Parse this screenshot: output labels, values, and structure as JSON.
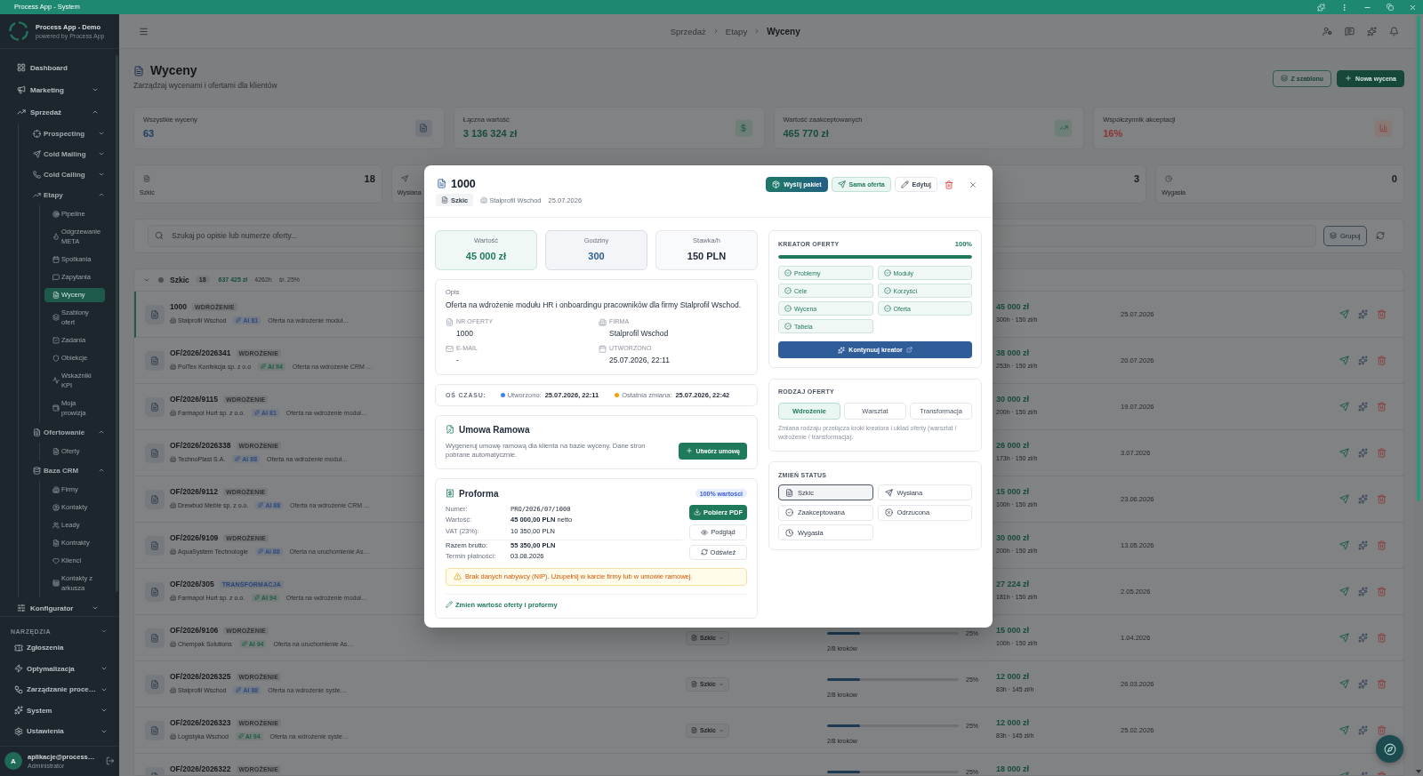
{
  "titlebar": {
    "title": "Process App - System"
  },
  "sidebar": {
    "app_name": "Process App - Demo",
    "tagline": "powered by Process App",
    "items": [
      {
        "label": "Dashboard",
        "selected": false
      },
      {
        "label": "Marketing",
        "selected": false,
        "expanded": false
      },
      {
        "label": "Sprzedaż",
        "selected": false,
        "expanded": true,
        "children": [
          {
            "label": "Prospecting",
            "selected": false,
            "expanded": false
          },
          {
            "label": "Cold Mailing",
            "selected": false,
            "expanded": false
          },
          {
            "label": "Cold Calling",
            "selected": false,
            "expanded": false
          },
          {
            "label": "Etapy",
            "selected": false,
            "expanded": true,
            "children": [
              {
                "label": "Pipeline",
                "selected": false
              },
              {
                "label": "Odgrzewanie META",
                "selected": false
              },
              {
                "label": "Spotkania",
                "selected": false
              },
              {
                "label": "Zapytania",
                "selected": false
              },
              {
                "label": "Wyceny",
                "selected": true
              },
              {
                "label": "Szablony ofert",
                "selected": false
              },
              {
                "label": "Zadania",
                "selected": false
              },
              {
                "label": "Obiekcje",
                "selected": false
              },
              {
                "label": "Wskaźniki KPI",
                "selected": false
              },
              {
                "label": "Moja prowizja",
                "selected": false
              }
            ]
          },
          {
            "label": "Ofertowanie",
            "selected": false,
            "expanded": true,
            "children": [
              {
                "label": "Oferty",
                "selected": false
              }
            ]
          },
          {
            "label": "Baza CRM",
            "selected": false,
            "expanded": true,
            "children": [
              {
                "label": "Firmy",
                "selected": false
              },
              {
                "label": "Kontakty",
                "selected": false
              },
              {
                "label": "Leady",
                "selected": false
              },
              {
                "label": "Kontrakty",
                "selected": false
              },
              {
                "label": "Klienci",
                "selected": false
              },
              {
                "label": "Kontakty z arkusza",
                "selected": false
              }
            ]
          }
        ]
      },
      {
        "label": "Konfigurator",
        "selected": false,
        "expanded": false
      }
    ],
    "tools": {
      "label": "NARZĘDZIA",
      "items": [
        {
          "label": "Zgłoszenia",
          "selected": false
        },
        {
          "label": "Optymalizacja",
          "selected": false,
          "expanded": false
        },
        {
          "label": "Zarządzanie proce…",
          "selected": false,
          "expanded": false
        },
        {
          "label": "System",
          "selected": false,
          "expanded": false
        },
        {
          "label": "Ustawienia",
          "selected": false,
          "expanded": false
        }
      ]
    },
    "user": {
      "initial": "A",
      "name": "aplikacje@process…",
      "role": "Administrator"
    }
  },
  "header": {
    "breadcrumbs": [
      "Sprzedaż",
      "Etapy",
      "Wyceny"
    ]
  },
  "page": {
    "title": "Wyceny",
    "subtitle": "Zarządzaj wycenami i ofertami dla klientów",
    "actions": [
      {
        "label": "Z szablonu",
        "kind": "template"
      },
      {
        "label": "Nowa wycena",
        "kind": "create"
      }
    ]
  },
  "stats": [
    {
      "label": "Wszystkie wyceny",
      "value": "63",
      "kind": "count"
    },
    {
      "label": "Łączna wartość",
      "value": "3 136 324 zł",
      "kind": "money"
    },
    {
      "label": "Wartość zaakceptowanych",
      "value": "465 770 zł",
      "kind": "accepted"
    },
    {
      "label": "Współczynnik akceptacji",
      "value": "16%",
      "kind": "rate"
    }
  ],
  "status_cards": [
    {
      "label": "Szkic",
      "count": "18"
    },
    {
      "label": "Wysłana"
    },
    {
      "count": "3"
    },
    {
      "label": "Wygasła",
      "count": "0"
    }
  ],
  "search": {
    "placeholder": "Szukaj po opisie lub numerze oferty...",
    "group_button": "Grupuj"
  },
  "group": {
    "label": "Szkic",
    "count": "18",
    "total": "637 425 zł",
    "hours": "4262h",
    "average": "śr. 25%",
    "expanded": true
  },
  "rows": [
    {
      "number": "1000",
      "tag": {
        "label": "WDROŻENIE",
        "color": "#2e3236"
      },
      "company": "Stalprofil Wschod",
      "ai": {
        "label": "AI 81",
        "color": "#2b4a82"
      },
      "description": "Oferta na wdrożenie moduł…",
      "value": "45 000 zł",
      "rate": "300h · 150 zł/h",
      "date": "25.07.2026",
      "selected": true
    },
    {
      "number": "OF/2026/2026341",
      "tag": {
        "label": "WDROŻENIE",
        "color": "#2e3236"
      },
      "company": "PolTex Konfekcja sp. z o.o",
      "ai": {
        "label": "AI 94",
        "color": "#1f5c45"
      },
      "description": "Oferta na wdrożenie CRM …",
      "value": "38 000 zł",
      "rate": "253h · 150 zł/h",
      "date": "20.07.2026",
      "selected": false
    },
    {
      "number": "OF/2026/9115",
      "tag": {
        "label": "WDROŻENIE",
        "color": "#2e3236"
      },
      "company": "Farmapol Hurt sp. z o.o.",
      "ai": {
        "label": "AI 81",
        "color": "#2b4a82"
      },
      "description": "Oferta na wdrożenie moduł…",
      "value": "30 000 zł",
      "rate": "200h · 150 zł/h",
      "date": "19.07.2026",
      "selected": false
    },
    {
      "number": "OF/2026/2026338",
      "tag": {
        "label": "WDROŻENIE",
        "color": "#2e3236"
      },
      "company": "TechnoPlast S.A.",
      "ai": {
        "label": "AI 88",
        "color": "#2b4a82"
      },
      "description": "Oferta na wdrożenie moduł…",
      "value": "26 000 zł",
      "rate": "173h · 150 zł/h",
      "date": "3.07.2026",
      "selected": false
    },
    {
      "number": "OF/2026/9112",
      "tag": {
        "label": "WDROŻENIE",
        "color": "#2e3236"
      },
      "company": "Drewbud Meble sp. z o.o.",
      "ai": {
        "label": "AI 88",
        "color": "#2b4a82"
      },
      "description": "Oferta na wdrożenie CRM …",
      "value": "15 000 zł",
      "rate": "100h · 150 zł/h",
      "date": "23.06.2026",
      "selected": false
    },
    {
      "number": "OF/2026/9109",
      "tag": {
        "label": "WDROŻENIE",
        "color": "#2e3236"
      },
      "company": "AquaSystem Technologie",
      "ai": {
        "label": "AI 88",
        "color": "#2b4a82"
      },
      "description": "Oferta na uruchomienie As…",
      "value": "30 000 zł",
      "rate": "200h · 150 zł/h",
      "date": "13.05.2026",
      "selected": false
    },
    {
      "number": "OF/2026/305",
      "tag": {
        "label": "TRANSFORMACJA",
        "color": "#27447a"
      },
      "company": "Farmapol Hurt sp. z o.o.",
      "ai": {
        "label": "AI 94",
        "color": "#1f5c45"
      },
      "description": "Oferta na wdrożenie moduł…",
      "value": "27 224 zł",
      "rate": "181h · 150 zł/h",
      "date": "2.05.2026",
      "selected": false
    },
    {
      "number": "OF/2026/9106",
      "tag": {
        "label": "WDROŻENIE",
        "color": "#2e3236"
      },
      "company": "Chempak Solutions",
      "ai": {
        "label": "AI 94",
        "color": "#1f5c45"
      },
      "description": "Oferta na uruchomienie As…",
      "status": "Szkic",
      "progress": {
        "level": 0.25,
        "percent": "25%",
        "steps": "2/8 kroków"
      },
      "value": "15 000 zł",
      "rate": "100h · 150 zł/h",
      "date": "1.04.2026",
      "selected": false
    },
    {
      "number": "OF/2026/2026325",
      "tag": {
        "label": "WDROŻENIE",
        "color": "#2e3236"
      },
      "company": "Stalprofil Wschod",
      "ai": {
        "label": "AI 88",
        "color": "#2b4a82"
      },
      "description": "Oferta na wdrożenie syste…",
      "status": "Szkic",
      "progress": {
        "level": 0.25,
        "percent": "25%",
        "steps": "2/8 kroków"
      },
      "value": "12 000 zł",
      "rate": "83h · 145 zł/h",
      "date": "26.03.2026",
      "selected": false
    },
    {
      "number": "OF/2026/2026323",
      "tag": {
        "label": "WDROŻENIE",
        "color": "#2e3236"
      },
      "company": "Logistyka Wschod",
      "ai": {
        "label": "AI 94",
        "color": "#1f5c45"
      },
      "description": "Oferta na wdrożenie syste…",
      "status": "Szkic",
      "progress": {
        "level": 0.25,
        "percent": "25%",
        "steps": "2/8 kroków"
      },
      "value": "12 000 zł",
      "rate": "83h · 145 zł/h",
      "date": "25.02.2026",
      "selected": false
    },
    {
      "number": "OF/2026/2026322",
      "tag": {
        "label": "WDROŻENIE",
        "color": "#2e3236"
      },
      "progress": {
        "level": 0.25,
        "percent": "25%"
      },
      "value": "18 000 zł",
      "selected": false
    }
  ],
  "modal": {
    "title": "1000",
    "status_chip": "Szkic",
    "company": "Stalprofil Wschod",
    "date": "25.07.2026",
    "actions": [
      {
        "label": "Wyślij pakiet",
        "kind": "package"
      },
      {
        "label": "Sama oferta",
        "kind": "offer"
      },
      {
        "label": "Edytuj",
        "kind": "edit"
      }
    ],
    "metrics": [
      {
        "label": "Wartość",
        "value": "45 000 zł",
        "kind": "money"
      },
      {
        "label": "Godziny",
        "value": "300",
        "kind": "hours"
      },
      {
        "label": "Stawka/h",
        "value": "150 PLN",
        "kind": "rate"
      }
    ],
    "description": {
      "label": "Opis",
      "text": "Oferta na wdrożenie modułu HR i onboardingu pracowników dla firmy Stalprofil Wschod.",
      "fields": [
        {
          "label": "NR OFERTY",
          "value": "1000"
        },
        {
          "label": "FIRMA",
          "value": "Stalprofil Wschod"
        },
        {
          "label": "E-MAIL",
          "value": "-"
        },
        {
          "label": "UTWORZONO",
          "value": "25.07.2026, 22:11"
        }
      ]
    },
    "timeline": {
      "label": "OŚ CZASU:",
      "events": [
        {
          "label": "Utworzono:",
          "value": "25.07.2026, 22:11",
          "color": "#3b82f6"
        },
        {
          "label": "Ostatnia zmiana:",
          "value": "25.07.2026, 22:42",
          "color": "#f59e0b"
        }
      ]
    },
    "contract": {
      "title": "Umowa Ramowa",
      "text": "Wygeneruj umowę ramową dla klienta na bazie wyceny. Dane stron pobrane automatycznie.",
      "button": "Utwórz umowę"
    },
    "proforma": {
      "title": "Proforma",
      "badge": "100% wartości",
      "lines": [
        {
          "label": "Numer:",
          "value": "PRO/2026/07/1000",
          "kind": "mono"
        },
        {
          "label": "Wartość:",
          "value": "**45 000,00 PLN** netto",
          "kind": "plain"
        },
        {
          "label": "VAT (23%):",
          "value": "10 350,00 PLN",
          "kind": "plain"
        },
        {
          "label": "Razem brutto:",
          "value": "55 350,00 PLN",
          "kind": "total"
        },
        {
          "label": "Termin płatności:",
          "value": "03.08.2026",
          "kind": "plain"
        }
      ],
      "buttons": [
        {
          "label": "Pobierz PDF",
          "kind": "pdf"
        },
        {
          "label": "Podgląd",
          "kind": "preview"
        },
        {
          "label": "Odśwież",
          "kind": "refresh"
        }
      ],
      "warning": "Brak danych nabywcy (NIP). Uzupełnij w karcie firmy lub w umowie ramowej.",
      "edit_link": "Zmień wartość oferty i proformy"
    },
    "wizard": {
      "title": "KREATOR OFERTY",
      "percent": "100%",
      "level": 1,
      "steps": [
        {
          "label": "Problemy",
          "done": true
        },
        {
          "label": "Moduły",
          "done": true
        },
        {
          "label": "Cele",
          "done": true
        },
        {
          "label": "Korzyści",
          "done": true
        },
        {
          "label": "Wycena",
          "done": true
        },
        {
          "label": "Oferta",
          "done": true
        },
        {
          "label": "Tabela",
          "done": true
        }
      ],
      "button": "Kontynuuj kreator"
    },
    "offer_type": {
      "title": "RODZAJ OFERTY",
      "options": [
        {
          "label": "Wdrożenie",
          "selected": true
        },
        {
          "label": "Warsztat",
          "selected": false
        },
        {
          "label": "Transformacja",
          "selected": false
        }
      ],
      "hint": "Zmiana rodzaju przełącza kroki kreatora i układ oferty (warsztat / wdrożenie / transformacja)."
    },
    "status": {
      "title": "ZMIEŃ STATUS",
      "options": [
        {
          "label": "Szkic",
          "selected": true
        },
        {
          "label": "Wysłana",
          "selected": false
        },
        {
          "label": "Zaakceptowana",
          "selected": false
        },
        {
          "label": "Odrzucona",
          "selected": false
        },
        {
          "label": "Wygasła",
          "selected": false
        }
      ]
    }
  }
}
